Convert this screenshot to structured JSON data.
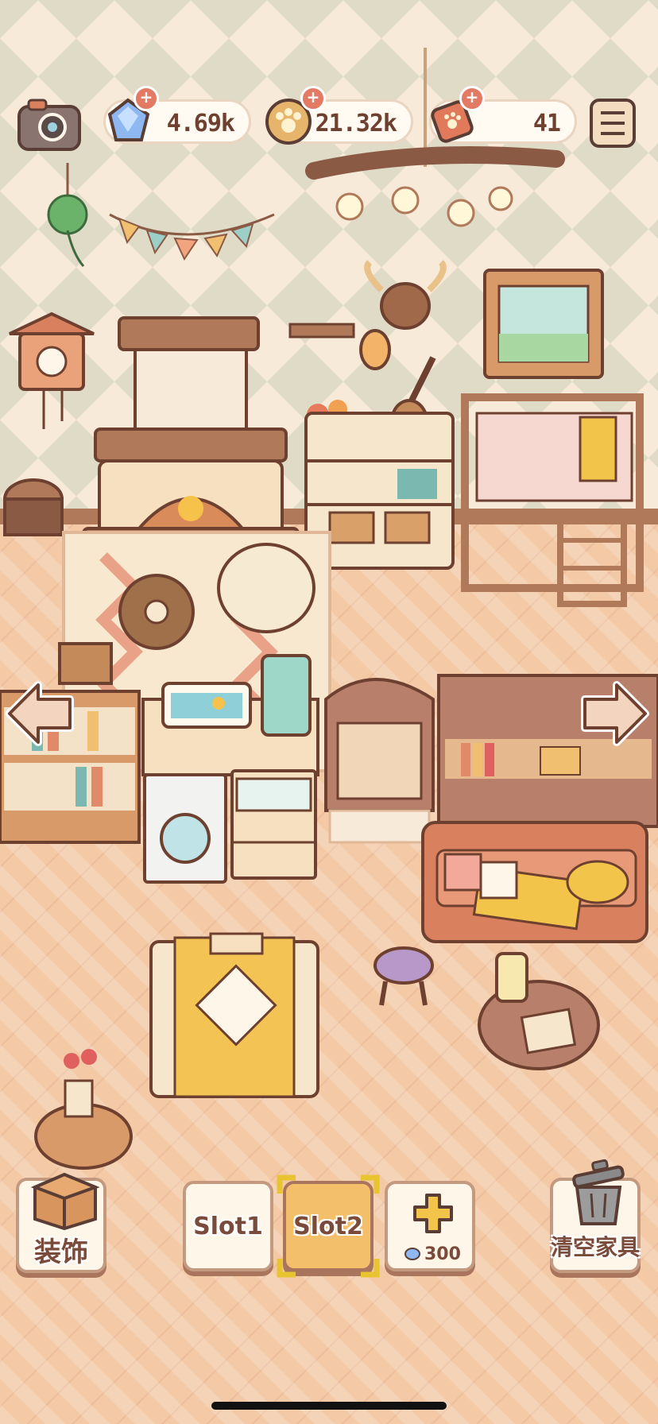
{
  "hud": {
    "gems": "4.69k",
    "coins": "21.32k",
    "tickets": "41"
  },
  "buttons": {
    "decorate_label": "装饰",
    "slot1_label": "Slot1",
    "slot2_label": "Slot2",
    "add_slot_cost": "300",
    "clear_label": "清空家具"
  },
  "colors": {
    "accent": "#e8b860",
    "brand_text": "#7a4a3a",
    "gem": "#7fa8e8",
    "coin": "#e6b46a",
    "ticket": "#e07a5a"
  }
}
